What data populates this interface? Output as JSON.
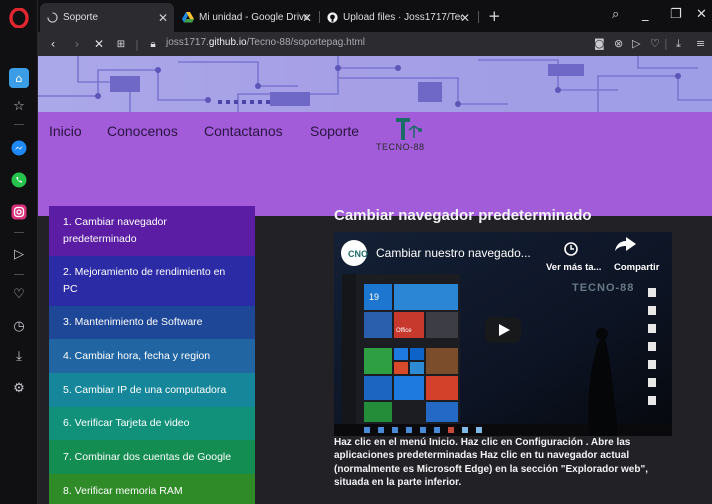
{
  "tabs": [
    {
      "title": "Soporte",
      "active": true,
      "icon": "loading-icon"
    },
    {
      "title": "Mi unidad - Google Drive",
      "active": false,
      "icon": "google-drive-icon"
    },
    {
      "title": "Upload files · Joss1717/Tec",
      "active": false,
      "icon": "github-icon"
    }
  ],
  "address": {
    "prefix": "joss1717.",
    "domain": "github.io",
    "path": "/Tecno-88/soportepag.html"
  },
  "site": {
    "nav": [
      "Inicio",
      "Conocenos",
      "Contactanos",
      "Soporte"
    ],
    "brand_text": "TECNO-88",
    "brand_colors": {
      "menu": "#a25bd9",
      "link": "#2a1540"
    }
  },
  "side_menu": [
    {
      "label": "1. Cambiar navegador predeterminado",
      "color": "#5a1da3"
    },
    {
      "label": "2. Mejoramiento de rendimiento en PC",
      "color": "#2b2ba6"
    },
    {
      "label": "3. Mantenimiento de Software",
      "color": "#1e4797"
    },
    {
      "label": "4. Cambiar hora, fecha y region",
      "color": "#2166a3"
    },
    {
      "label": "5. Cambiar IP de una computadora",
      "color": "#16879a"
    },
    {
      "label": "6. Verificar Tarjeta de video",
      "color": "#11917a"
    },
    {
      "label": "7. Combinar dos cuentas de Google",
      "color": "#138d51"
    },
    {
      "label": "8. Verificar memoria RAM",
      "color": "#2f8a28"
    }
  ],
  "article": {
    "title": "Cambiar navegador predeterminado",
    "body": "Haz clic en el menú Inicio. Haz clic en Configuración . Abre las aplicaciones predeterminadas Haz clic en tu navegador actual (normalmente es Microsoft Edge) en la sección \"Explorador web\", situada en la parte inferior."
  },
  "video": {
    "title": "Cambiar nuestro navegado...",
    "watch_later": "Ver más ta...",
    "share": "Compartir",
    "channel_watermark": "TECNO-88",
    "tile_labels": [
      "19",
      "Office"
    ]
  }
}
